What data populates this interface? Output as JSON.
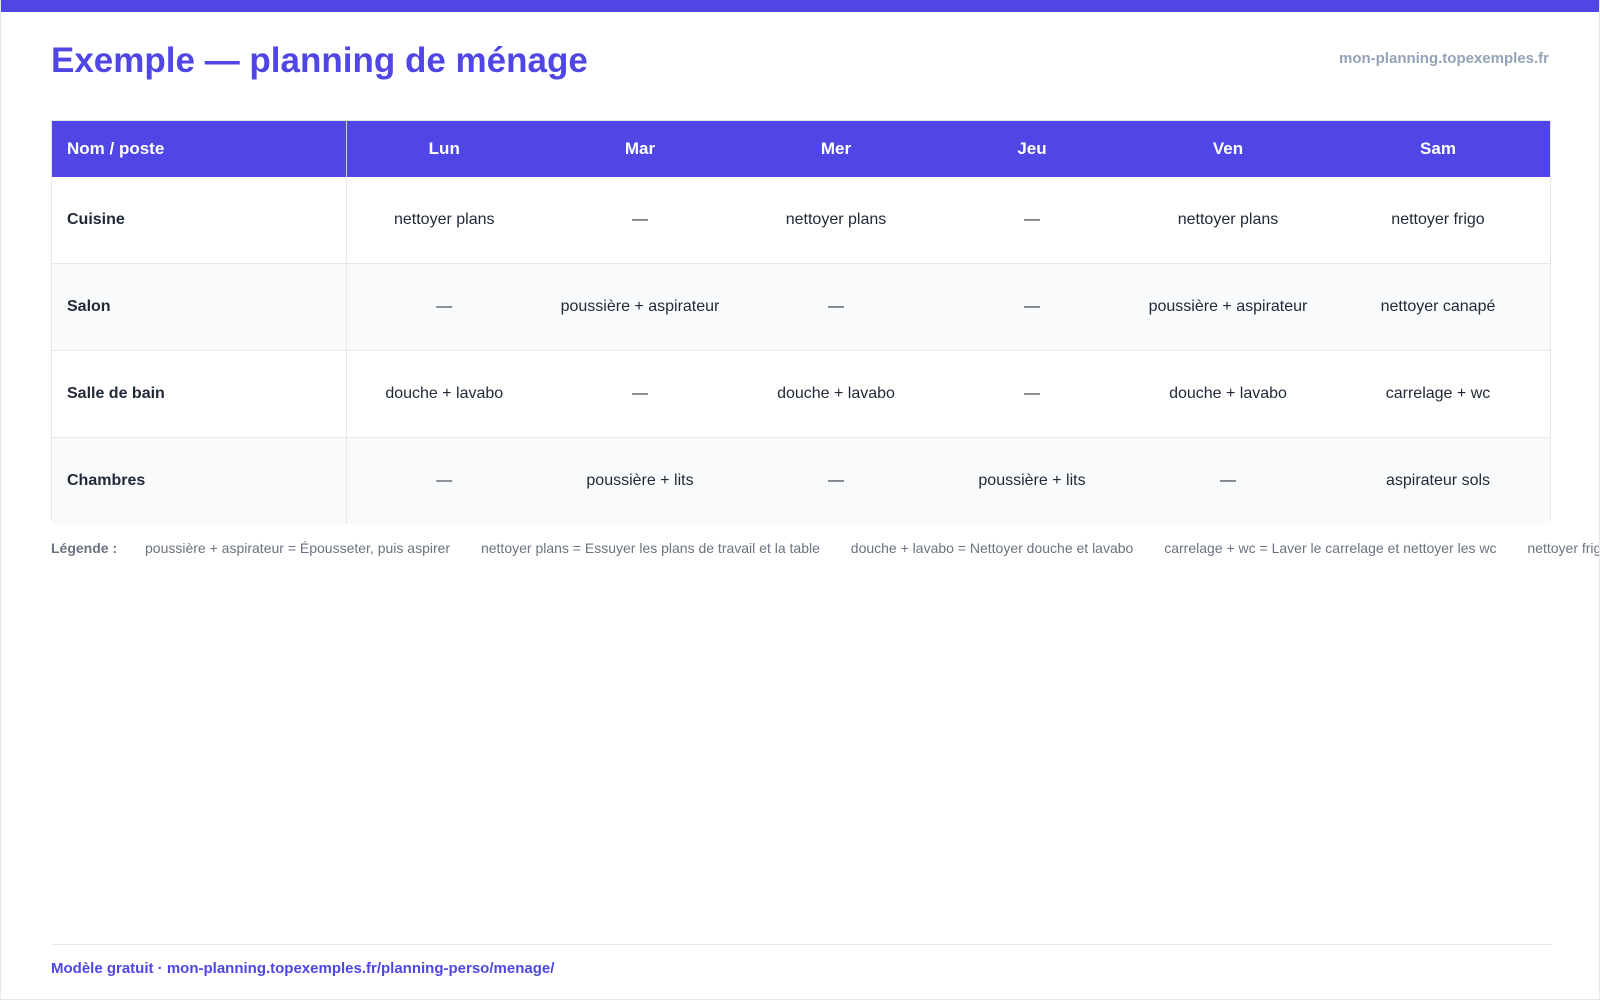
{
  "header": {
    "title": "Exemple — planning de ménage",
    "site": "mon-planning.topexemples.fr"
  },
  "colors": {
    "accent": "#4f46e5",
    "header_text": "#ffffff",
    "muted": "#94a3b8",
    "row_alt": "#f8fafc"
  },
  "table": {
    "columns": [
      "Nom / poste",
      "Lun",
      "Mar",
      "Mer",
      "Jeu",
      "Ven",
      "Sam"
    ],
    "rows": [
      {
        "label": "Cuisine",
        "cells": [
          "nettoyer plans",
          "—",
          "nettoyer plans",
          "—",
          "nettoyer plans",
          "nettoyer frigo"
        ]
      },
      {
        "label": "Salon",
        "cells": [
          "—",
          "poussière + aspirateur",
          "—",
          "—",
          "poussière + aspirateur",
          "nettoyer canapé"
        ]
      },
      {
        "label": "Salle de bain",
        "cells": [
          "douche + lavabo",
          "—",
          "douche + lavabo",
          "—",
          "douche + lavabo",
          "carrelage + wc"
        ]
      },
      {
        "label": "Chambres",
        "cells": [
          "—",
          "poussière + lits",
          "—",
          "poussière + lits",
          "—",
          "aspirateur sols"
        ]
      }
    ]
  },
  "legend": {
    "title": "Légende :",
    "items": [
      "poussière + aspirateur = Épousseter, puis aspirer",
      "nettoyer plans = Essuyer les plans de travail et la table",
      "douche + lavabo = Nettoyer douche et lavabo",
      "carrelage + wc = Laver le carrelage et nettoyer les wc",
      "nettoyer frig"
    ]
  },
  "footer": {
    "text": "Modèle gratuit · mon-planning.topexemples.fr/planning-perso/menage/"
  }
}
